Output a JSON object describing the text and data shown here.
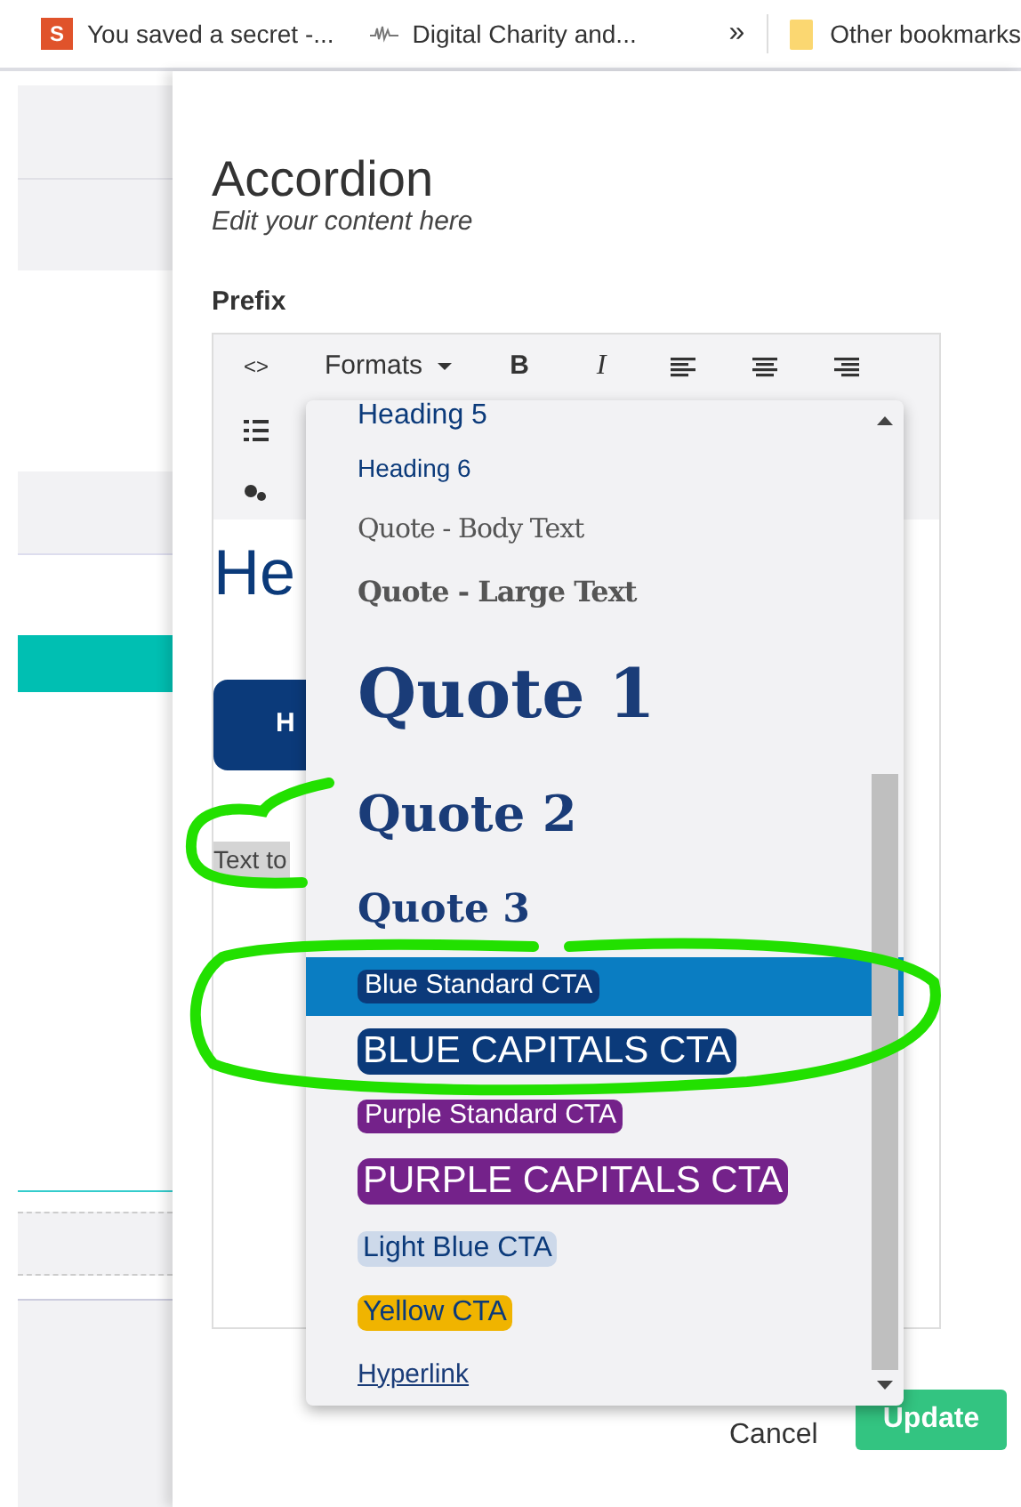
{
  "bookmarks_bar": {
    "items": [
      {
        "label": "You saved a secret -...",
        "kind": "letter",
        "icon_text": "S"
      },
      {
        "label": "Digital Charity and...",
        "kind": "wave"
      }
    ],
    "overflow": "»",
    "other": "Other bookmarks"
  },
  "modal": {
    "title": "Accordion",
    "subtitle": "Edit your content here",
    "field_label": "Prefix",
    "toolbar": {
      "code": "<>",
      "formats": "Formats",
      "bold": "B",
      "italic": "I"
    },
    "content": {
      "heading": "He",
      "button": "H",
      "text": "Text to"
    },
    "formats_menu": [
      {
        "label": "Heading 5",
        "kind": "h5",
        "selected": false
      },
      {
        "label": "Heading 6",
        "kind": "h6",
        "selected": false
      },
      {
        "label": "Quote - Body Text",
        "kind": "quotebody",
        "selected": false
      },
      {
        "label": "Quote - Large Text",
        "kind": "quotelarge",
        "selected": false
      },
      {
        "label": "Quote 1",
        "kind": "quote1",
        "selected": false
      },
      {
        "label": "Quote 2",
        "kind": "quote2",
        "selected": false
      },
      {
        "label": "Quote 3",
        "kind": "quote3",
        "selected": false
      },
      {
        "label": "Blue Standard CTA",
        "kind": "ctasmall",
        "color": "#0b3a7a",
        "selected": true
      },
      {
        "label": "BLUE CAPITALS CTA",
        "kind": "ctalarge",
        "color": "#0b3a7a",
        "selected": false
      },
      {
        "label": "Purple Standard CTA",
        "kind": "ctasmall",
        "color": "#74228a",
        "selected": false
      },
      {
        "label": "PURPLE CAPITALS CTA",
        "kind": "ctalarge",
        "color": "#74228a",
        "selected": false
      },
      {
        "label": "Light Blue CTA",
        "kind": "ctalight",
        "color": "#cdd9ea",
        "selected": false
      },
      {
        "label": "Yellow CTA",
        "kind": "ctalight",
        "color": "#f0b400",
        "selected": false
      },
      {
        "label": "Hyperlink",
        "kind": "link",
        "selected": false
      }
    ],
    "cancel": "Cancel",
    "update": "Update"
  }
}
